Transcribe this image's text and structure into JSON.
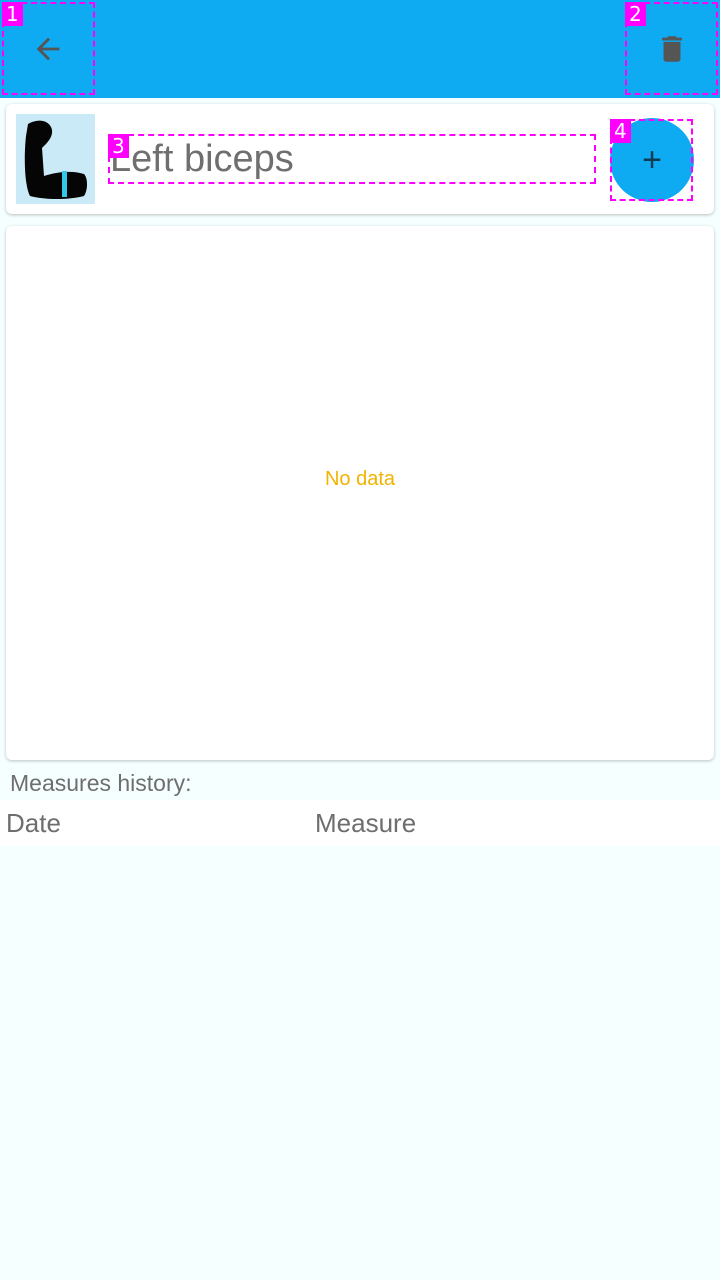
{
  "appbar": {
    "back_icon": "arrow-left-icon",
    "delete_icon": "trash-icon",
    "color": "#0eaaf2"
  },
  "measure": {
    "title": "Left biceps",
    "add_label": "+",
    "thumbnail_icon": "flexed-arm-icon"
  },
  "chart": {
    "empty_text": "No data"
  },
  "history": {
    "label": "Measures history:",
    "columns": [
      "Date",
      "Measure"
    ]
  },
  "markers": [
    "1",
    "2",
    "3",
    "4"
  ]
}
